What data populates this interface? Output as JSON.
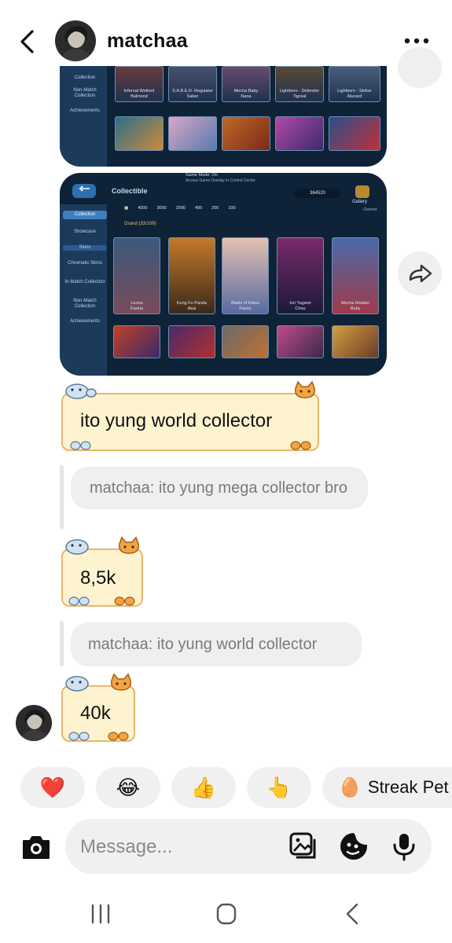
{
  "header": {
    "contact_name": "matchaa"
  },
  "screenshot1": {
    "side_items": [
      "Collection",
      "Non-Match Collection",
      "Achievements"
    ],
    "card_labels": [
      "Infernal Wetlord\nBalmond",
      "S.A.B.E.R. Regulator\nSaber",
      "Mecha Baby\nNana",
      "Lightborn - Defender\nTigreal",
      "Lightborn - Striker\nAlucard"
    ]
  },
  "screenshot2": {
    "top_note": "Game Mode: On",
    "top_note2": "Access Game Overlay in Control Center",
    "title": "Collectible",
    "count": "364520",
    "gallery": "Gallery",
    "owned": "Owned",
    "filters": [
      "4000",
      "3000",
      "2000",
      "400",
      "200",
      "100"
    ],
    "grand": "Grand (33/109)",
    "side_items": [
      "Collection",
      "Showcase",
      "Skins",
      "Chromatic Skins",
      "In-Match Collection",
      "Non-Match Collection",
      "Achievements"
    ],
    "card_labels": [
      "Leona\nKarina",
      "Kung Fu Panda\nAkai",
      "Blade of Kibou\nFanny",
      "Iori Yagami\nChou",
      "Mecha Maiden\nRuby"
    ]
  },
  "messages": [
    {
      "type": "sticker",
      "text": "ito yung world collector"
    },
    {
      "type": "reply",
      "text": "matchaa: ito yung mega collector bro"
    },
    {
      "type": "sticker",
      "text": "8,5k"
    },
    {
      "type": "reply",
      "text": "matchaa: ito yung world collector"
    },
    {
      "type": "sticker",
      "text": "40k"
    }
  ],
  "quick_reactions": [
    {
      "emoji": "❤️",
      "icon": "heart-icon"
    },
    {
      "emoji": "😂",
      "icon": "laughing-face-icon"
    },
    {
      "emoji": "👍",
      "icon": "thumbs-up-icon"
    },
    {
      "emoji": "👆",
      "icon": "pointing-up-icon"
    },
    {
      "emoji": "🥚",
      "label": "Streak Pet",
      "icon": "egg-icon"
    }
  ],
  "composer": {
    "placeholder": "Message..."
  },
  "colors": {
    "sticker_bg": "#fdf3cf",
    "sticker_border": "#e9b66b",
    "reply_bg": "#efefef",
    "heart": "#e0245e"
  }
}
